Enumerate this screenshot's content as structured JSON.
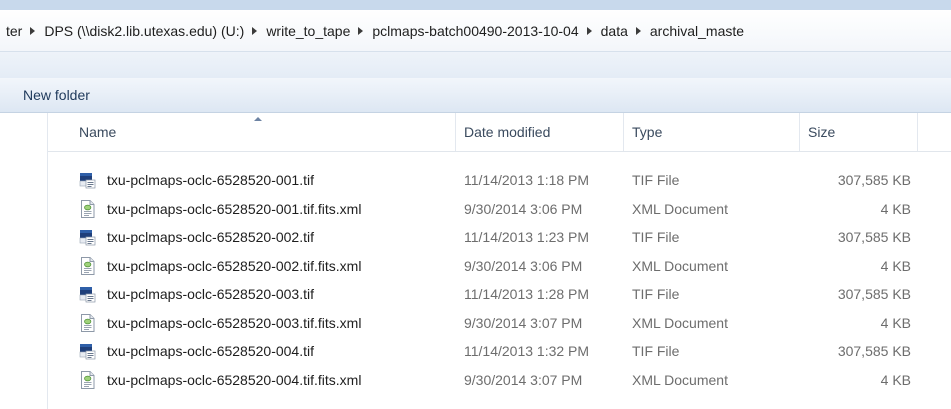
{
  "address": {
    "segments": [
      "ter",
      "DPS (\\\\disk2.lib.utexas.edu) (U:)",
      "write_to_tape",
      "pclmaps-batch00490-2013-10-04",
      "data",
      "archival_maste"
    ]
  },
  "toolbar": {
    "new_folder_label": "New folder"
  },
  "columns": {
    "name": "Name",
    "date": "Date modified",
    "type": "Type",
    "size": "Size"
  },
  "files": [
    {
      "name": "txu-pclmaps-oclc-6528520-001.tif",
      "date": "11/14/2013 1:18 PM",
      "type": "TIF File",
      "size": "307,585 KB",
      "icon": "tif-image-icon"
    },
    {
      "name": "txu-pclmaps-oclc-6528520-001.tif.fits.xml",
      "date": "9/30/2014 3:06 PM",
      "type": "XML Document",
      "size": "4 KB",
      "icon": "xml-document-icon"
    },
    {
      "name": "txu-pclmaps-oclc-6528520-002.tif",
      "date": "11/14/2013 1:23 PM",
      "type": "TIF File",
      "size": "307,585 KB",
      "icon": "tif-image-icon"
    },
    {
      "name": "txu-pclmaps-oclc-6528520-002.tif.fits.xml",
      "date": "9/30/2014 3:06 PM",
      "type": "XML Document",
      "size": "4 KB",
      "icon": "xml-document-icon"
    },
    {
      "name": "txu-pclmaps-oclc-6528520-003.tif",
      "date": "11/14/2013 1:28 PM",
      "type": "TIF File",
      "size": "307,585 KB",
      "icon": "tif-image-icon"
    },
    {
      "name": "txu-pclmaps-oclc-6528520-003.tif.fits.xml",
      "date": "9/30/2014 3:07 PM",
      "type": "XML Document",
      "size": "4 KB",
      "icon": "xml-document-icon"
    },
    {
      "name": "txu-pclmaps-oclc-6528520-004.tif",
      "date": "11/14/2013 1:32 PM",
      "type": "TIF File",
      "size": "307,585 KB",
      "icon": "tif-image-icon"
    },
    {
      "name": "txu-pclmaps-oclc-6528520-004.tif.fits.xml",
      "date": "9/30/2014 3:07 PM",
      "type": "XML Document",
      "size": "4 KB",
      "icon": "xml-document-icon"
    }
  ]
}
